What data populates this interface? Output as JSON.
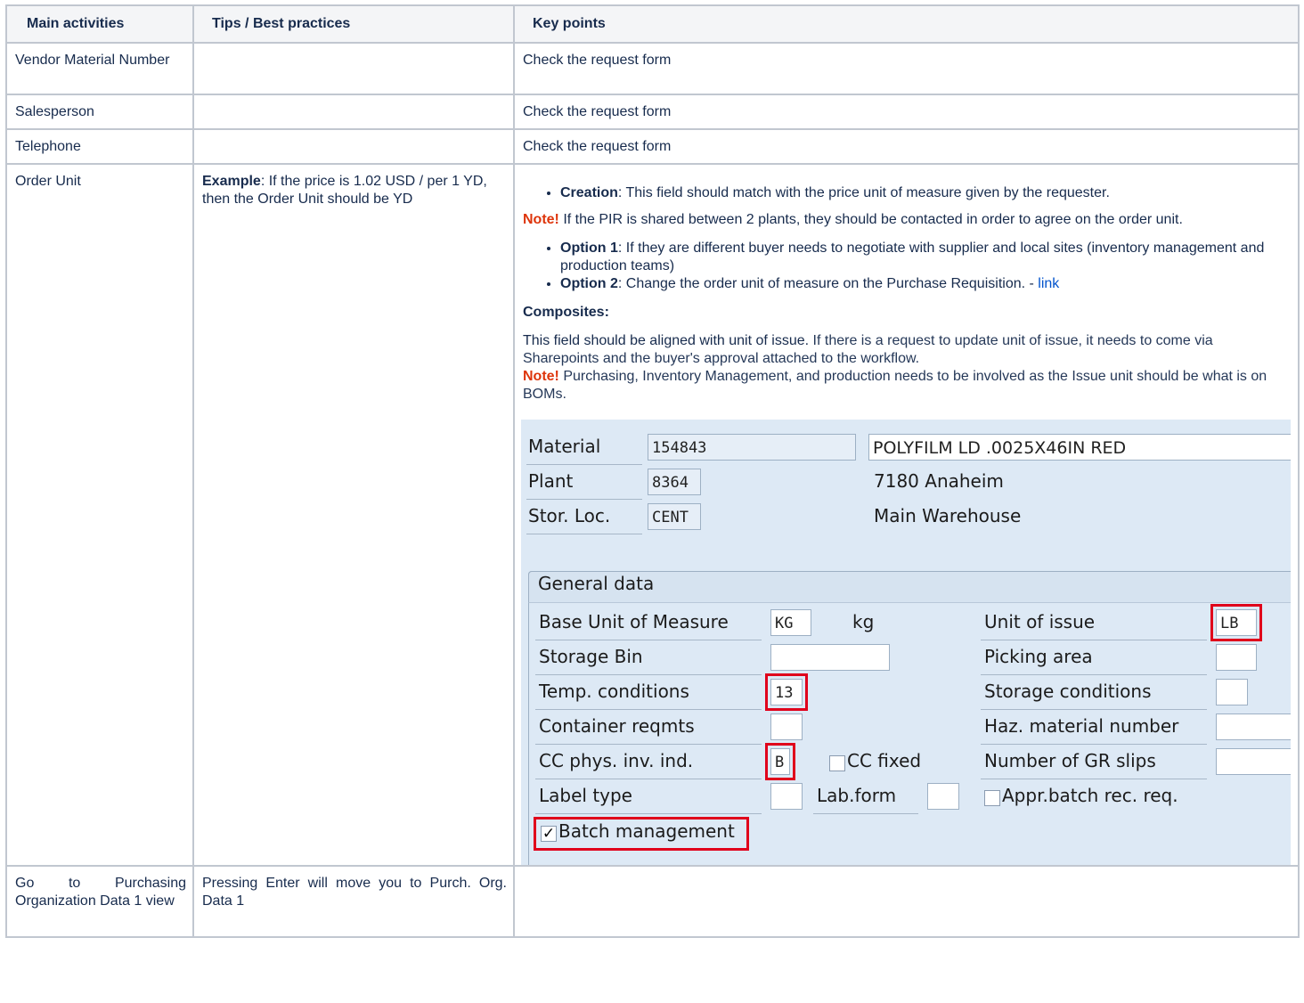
{
  "headers": [
    "Main activities",
    "Tips / Best practices",
    "Key points"
  ],
  "rows": [
    {
      "activity": "Vendor Material Number",
      "tips": "",
      "key": "Check the request form"
    },
    {
      "activity": "Salesperson",
      "tips": "",
      "key": "Check the request form"
    },
    {
      "activity": "Telephone",
      "tips": "",
      "key": "Check the request form"
    }
  ],
  "order_unit": {
    "activity": "Order Unit",
    "tips_bold": "Example",
    "tips_text": ": If the price is 1.02 USD / per 1 YD, then the Order Unit should be YD",
    "creation_bold": "Creation",
    "creation_text": ": This field should match with the price unit of measure given by the requester.",
    "note_label": "Note!",
    "note1_text": " If the PIR is shared between 2 plants, they should be contacted in order to agree on the order unit.",
    "option1_bold": "Option 1",
    "option1_text": ": If they are different buyer needs to negotiate with supplier and local sites (inventory management and production teams)",
    "option2_bold": "Option 2",
    "option2_text": ": Change the order unit of measure on the Purchase Requisition. - ",
    "link_text": "link",
    "composites_title": "Composites:",
    "composites_text1": "This field should be aligned with unit of issue. ",
    "composites_text2": "If there is a request to update unit of issue, it needs to come via Sharepoints and the buyer's approval attached to the workflow.",
    "note2_text": " Purchasing, Inventory Management, and production needs to be involved as the Issue unit should be what is on BOMs."
  },
  "sap": {
    "material_label": "Material",
    "material_value": "154843",
    "material_desc": "POLYFILM LD .0025X46IN RED",
    "plant_label": "Plant",
    "plant_value": "8364",
    "plant_desc": "7180 Anaheim",
    "storloc_label": "Stor. Loc.",
    "storloc_value": "CENT",
    "storloc_desc": "Main Warehouse",
    "group_title": "General data",
    "base_uom_label": "Base Unit of Measure",
    "base_uom_value": "KG",
    "base_uom_text": "kg",
    "unit_issue_label": "Unit of issue",
    "unit_issue_value": "LB",
    "storage_bin_label": "Storage Bin",
    "picking_area_label": "Picking area",
    "temp_label": "Temp. conditions",
    "temp_value": "13",
    "storage_cond_label": "Storage conditions",
    "container_label": "Container reqmts",
    "haz_label": "Haz. material number",
    "cc_label": "CC phys. inv. ind.",
    "cc_value": "B",
    "cc_fixed_label": "CC fixed",
    "gr_slips_label": "Number of GR slips",
    "label_type_label": "Label type",
    "lab_form_label": "Lab.form",
    "appr_batch_label": "Appr.batch rec. req.",
    "batch_mgmt_label": "Batch management",
    "check_mark": "✓"
  },
  "last_row": {
    "activity": "Go to Purchasing Organization Data 1 view",
    "tips": "Pressing Enter will move you to Purch. Org. Data 1",
    "key": ""
  }
}
